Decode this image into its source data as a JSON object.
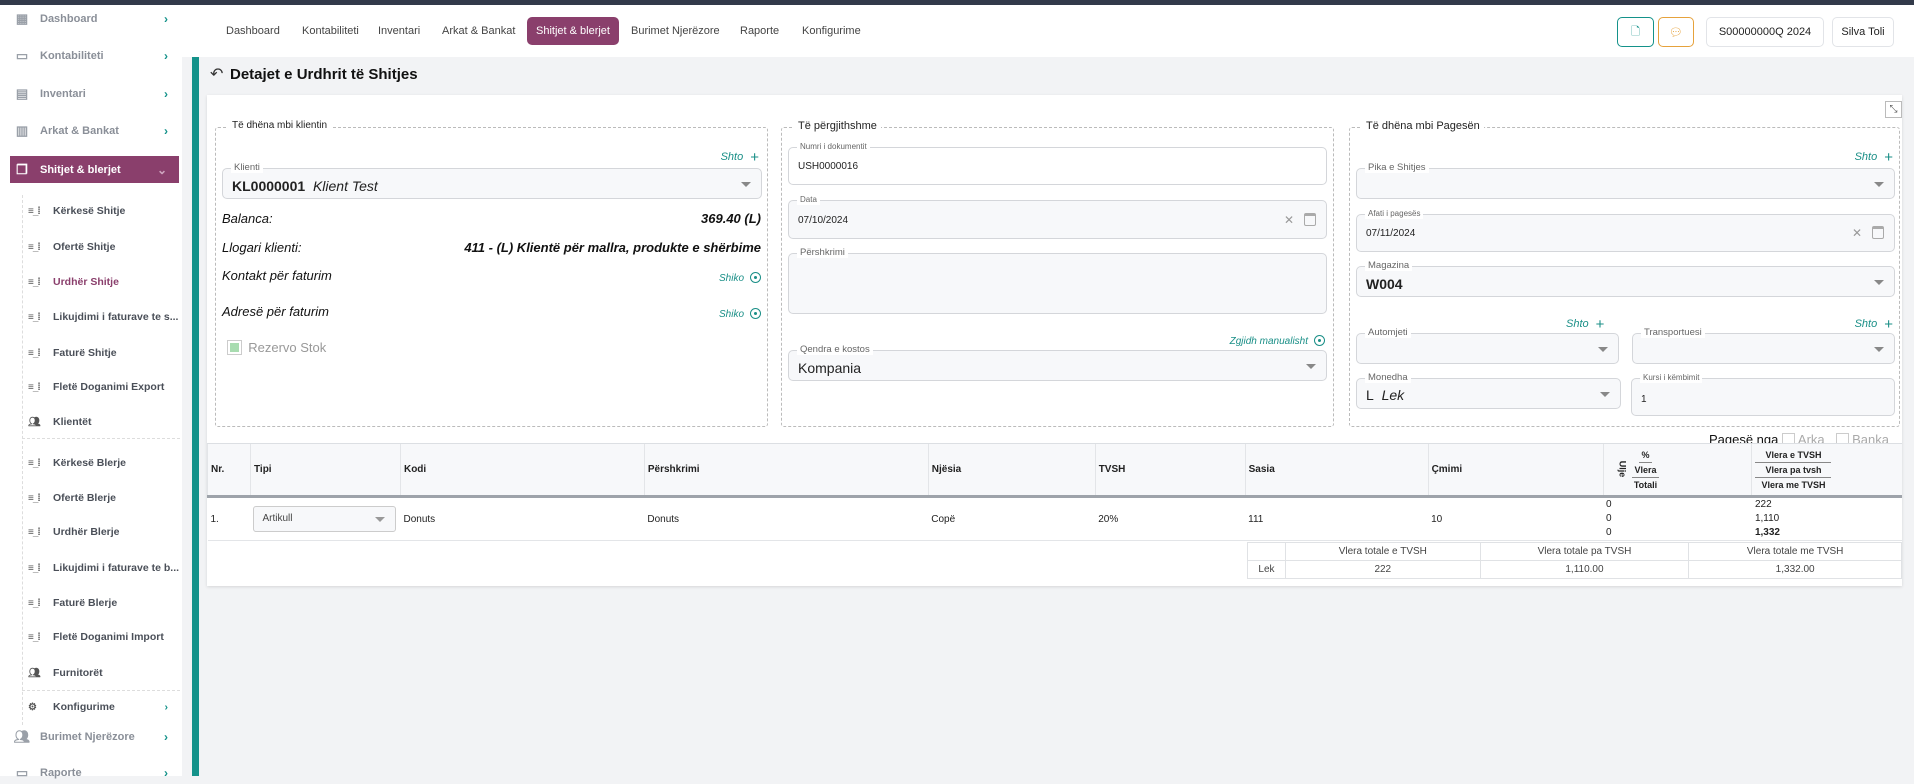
{
  "sidebar": {
    "items": [
      {
        "label": "Dashboard",
        "icon": "grid-icon"
      },
      {
        "label": "Kontabiliteti",
        "icon": "folder-icon"
      },
      {
        "label": "Inventari",
        "icon": "card-icon"
      },
      {
        "label": "Arkat & Bankat",
        "icon": "bank-icon"
      },
      {
        "label": "Shitjet & blerjet",
        "icon": "copy-icon"
      }
    ],
    "sub_sales": [
      "Kërkesë Shitje",
      "Ofertë Shitje",
      "Urdhër Shitje",
      "Likujdimi i faturave te s...",
      "Faturë Shitje",
      "Fletë Doganimi Export",
      "Klientët"
    ],
    "sub_purchase": [
      "Kërkesë Blerje",
      "Ofertë Blerje",
      "Urdhër Blerje",
      "Likujdimi i faturave te b...",
      "Faturë Blerje",
      "Fletë Doganimi Import",
      "Furnitorët"
    ],
    "konfigurime": "Konfigurime",
    "burimet": "Burimet Njerëzore",
    "raporte": "Raporte"
  },
  "nav": {
    "tabs": [
      "Dashboard",
      "Kontabiliteti",
      "Inventari",
      "Arkat & Bankat",
      "Shitjet & blerjet",
      "Burimet Njerëzore",
      "Raporte",
      "Konfigurime"
    ],
    "company": "S00000000Q  2024",
    "user": "Silva Toli"
  },
  "page": {
    "title": "Detajet e Urdhrit të Shitjes"
  },
  "client": {
    "legend": "Të dhëna mbi klientin",
    "shto": "Shto",
    "klienti_label": "Klienti",
    "klienti_code": "KL0000001",
    "klienti_name": "Klient Test",
    "balanca_label": "Balanca:",
    "balanca": "369.40 (L)",
    "llogari_label": "Llogari klienti:",
    "llogari": "411 - (L) Klientë për mallra, produkte e shërbime",
    "kontakt": "Kontakt për faturim",
    "adrese": "Adresë për faturim",
    "shiko": "Shiko",
    "rezervo": "Rezervo Stok"
  },
  "general": {
    "legend": "Të përgjithshme",
    "numri_label": "Numri i dokumentit",
    "numri": "USH0000016",
    "data_label": "Data",
    "data": "07/10/2024",
    "pershkrimi_label": "Përshkrimi",
    "pershkrimi": "",
    "zgjidh": "Zgjidh manualisht",
    "qendra_label": "Qendra e kostos",
    "qendra": "Kompania"
  },
  "payment": {
    "legend": "Të dhëna mbi Pagesën",
    "shto": "Shto",
    "pika_label": "Pika e Shitjes",
    "afati_label": "Afati i pagesës",
    "afati": "07/11/2024",
    "magazina_label": "Magazina",
    "magazina": "W004",
    "automjeti_label": "Automjeti",
    "transportuesi_label": "Transportuesi",
    "monedha_label": "Monedha",
    "monedha_symbol": "L",
    "monedha": "Lek",
    "kursi_label": "Kursi i këmbimit",
    "kursi": "1",
    "pagese_nga": "Pagesë nga",
    "arka": "Arka",
    "banka": "Banka"
  },
  "table": {
    "headers": [
      "Nr.",
      "Tipi",
      "Kodi",
      "Përshkrimi",
      "Njësia",
      "TVSH",
      "Sasia",
      "Çmimi"
    ],
    "ulje_label": "Ulje",
    "ulje_sub": [
      "%",
      "Vlera",
      "Totali"
    ],
    "vlera_sub": [
      "Vlera e TVSH",
      "Vlera pa tvsh",
      "Vlera me TVSH"
    ],
    "rows": [
      {
        "nr": "1.",
        "tipi": "Artikull",
        "kodi": "Donuts",
        "pershkrimi": "Donuts",
        "njesia": "Copë",
        "tvsh": "20%",
        "sasia": "111",
        "cmimi": "10",
        "ulje": [
          "0",
          "0",
          "0"
        ],
        "vlera": [
          "222",
          "1,110",
          "1,332"
        ]
      }
    ]
  },
  "totals": {
    "headers": [
      "Vlera totale e TVSH",
      "Vlera totale pa TVSH",
      "Vlera totale me TVSH"
    ],
    "currency": "Lek",
    "values": [
      "222",
      "1,110.00",
      "1,332.00"
    ]
  },
  "colors": {
    "accent": "#8a3f6c",
    "teal": "#14928a"
  }
}
